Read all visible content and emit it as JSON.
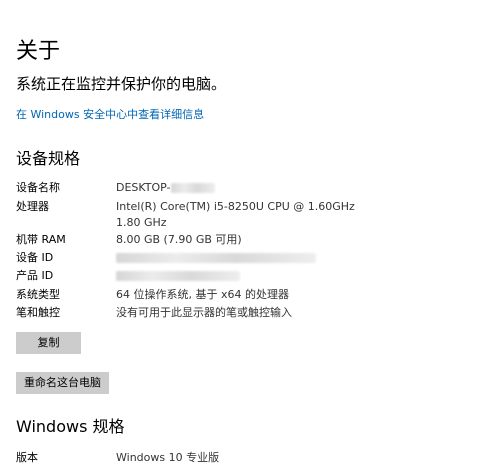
{
  "about": {
    "title": "关于",
    "subtitle": "系统正在监控并保护你的电脑。",
    "security_link": "在 Windows 安全中心中查看详细信息"
  },
  "device_specs": {
    "heading": "设备规格",
    "rows": [
      {
        "label": "设备名称",
        "value": "DESKTOP-",
        "redacted": true
      },
      {
        "label": "处理器",
        "value": "Intel(R) Core(TM) i5-8250U CPU @ 1.60GHz   1.80 GHz"
      },
      {
        "label": "机带 RAM",
        "value": "8.00 GB (7.90 GB 可用)"
      },
      {
        "label": "设备 ID",
        "value": "",
        "redacted": true
      },
      {
        "label": "产品 ID",
        "value": "",
        "redacted": true
      },
      {
        "label": "系统类型",
        "value": "64 位操作系统, 基于 x64 的处理器"
      },
      {
        "label": "笔和触控",
        "value": "没有可用于此显示器的笔或触控输入"
      }
    ],
    "copy_button": "复制",
    "rename_button": "重命名这台电脑"
  },
  "windows_specs": {
    "heading": "Windows 规格",
    "rows": [
      {
        "label": "版本",
        "value": "Windows 10 专业版"
      }
    ]
  },
  "colors": {
    "link": "#0066b4",
    "button_bg": "#cccccc"
  }
}
